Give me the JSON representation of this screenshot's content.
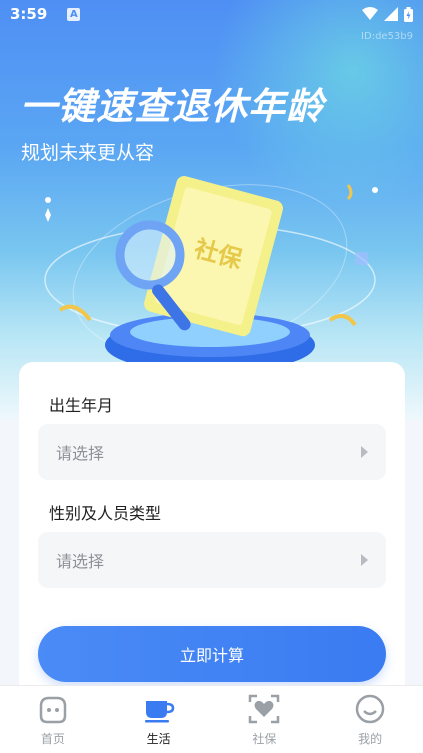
{
  "status_bar": {
    "time": "3:59",
    "notification_badge": "A"
  },
  "screen_id": "ID:de53b9",
  "hero": {
    "title": "一键速查退休年龄",
    "subtitle": "规划未来更从容"
  },
  "form": {
    "birth_label": "出生年月",
    "birth_value": "请选择",
    "type_label": "性别及人员类型",
    "type_value": "请选择",
    "submit_label": "立即计算"
  },
  "tabs": [
    {
      "label": "首页",
      "icon": "home-icon",
      "active": false
    },
    {
      "label": "生活",
      "icon": "cup-icon",
      "active": true
    },
    {
      "label": "社保",
      "icon": "heart-scan-icon",
      "active": false
    },
    {
      "label": "我的",
      "icon": "smile-icon",
      "active": false
    }
  ],
  "colors": {
    "accent": "#3a7bf2",
    "hero_top": "#4f8ff4",
    "tab_active": "#3a7bf2"
  }
}
